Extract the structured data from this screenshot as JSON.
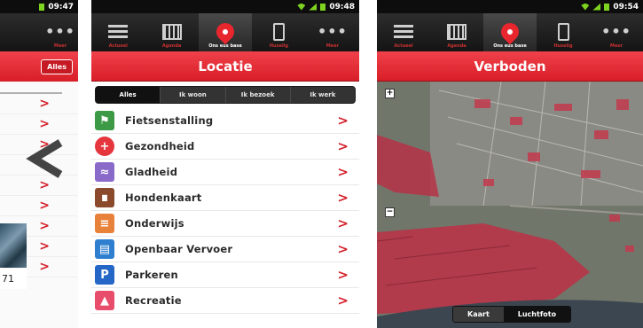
{
  "left_screen": {
    "status_time": "09:47",
    "tab_label": "Meer",
    "alles_label": "Alles",
    "back_arrow_icon": "back-arrow-icon",
    "photo_caption": "71"
  },
  "middle_screen": {
    "status_time": "09:48",
    "tabs": [
      {
        "label": "Actueel",
        "icon": "list-icon"
      },
      {
        "label": "Agenda",
        "icon": "calendar-icon"
      },
      {
        "label": "Ons eus base",
        "icon": "location-pin-icon"
      },
      {
        "label": "Huselig",
        "icon": "phone-icon"
      },
      {
        "label": "Meer",
        "icon": "more-dots-icon"
      }
    ],
    "title": "Locatie",
    "filters": [
      "Alles",
      "Ik woon",
      "Ik bezoek",
      "Ik werk"
    ],
    "items": [
      {
        "label": "Fietsenstalling",
        "icon": "bike-parking-icon",
        "color": "#3c9a46"
      },
      {
        "label": "Gezondheid",
        "icon": "health-cross-icon",
        "color": "#e5353d"
      },
      {
        "label": "Gladheid",
        "icon": "slippery-icon",
        "color": "#8a6ac8"
      },
      {
        "label": "Hondenkaart",
        "icon": "dog-icon",
        "color": "#8b4a2b"
      },
      {
        "label": "Onderwijs",
        "icon": "school-icon",
        "color": "#e8813a"
      },
      {
        "label": "Openbaar Vervoer",
        "icon": "bus-icon",
        "color": "#2f7fd0"
      },
      {
        "label": "Parkeren",
        "icon": "parking-icon",
        "color": "#2467c7"
      },
      {
        "label": "Recreatie",
        "icon": "tree-icon",
        "color": "#e84d6c"
      }
    ]
  },
  "right_screen": {
    "status_time": "09:54",
    "tabs": [
      {
        "label": "Actueel",
        "icon": "list-icon"
      },
      {
        "label": "Agenda",
        "icon": "calendar-icon"
      },
      {
        "label": "Ons eus base",
        "icon": "location-pin-icon"
      },
      {
        "label": "Huselig",
        "icon": "phone-icon"
      },
      {
        "label": "Meer",
        "icon": "more-dots-icon"
      }
    ],
    "title": "Verboden",
    "zoom_in": "+",
    "zoom_out": "−",
    "map_toggle": [
      "Kaart",
      "Luchtfoto"
    ]
  },
  "colors": {
    "accent_red": "#d81e28",
    "dark_bar": "#141414"
  }
}
